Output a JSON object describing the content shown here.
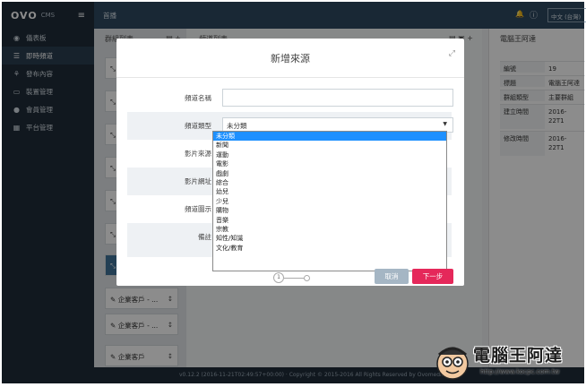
{
  "brand": {
    "logo": "OVO",
    "cms": "CMS",
    "menu_icon": "hamburger-icon"
  },
  "sidebar": {
    "items": [
      {
        "label": "儀表板",
        "icon": "dashboard-icon",
        "active": false
      },
      {
        "label": "即時頻道",
        "icon": "list-icon",
        "active": true
      },
      {
        "label": "發布內容",
        "icon": "share-icon",
        "active": false
      },
      {
        "label": "裝置管理",
        "icon": "monitor-icon",
        "active": false
      },
      {
        "label": "會員管理",
        "icon": "user-icon",
        "active": false
      },
      {
        "label": "平台管理",
        "icon": "grid-icon",
        "active": false
      }
    ]
  },
  "topbar": {
    "breadcrumb": "首播",
    "language": "中文 (台灣)"
  },
  "left_column": {
    "title": "群組列表",
    "cards": [
      "",
      "",
      "",
      "",
      "",
      "",
      "",
      "",
      "企業客戶 - ...",
      "企業客戶 - ...",
      "企業客戶"
    ]
  },
  "middle_column": {
    "title": "頻道列表"
  },
  "right_column": {
    "title": "電腦王阿達",
    "rows": [
      {
        "k": "編號",
        "v": "19"
      },
      {
        "k": "標題",
        "v": "電腦王阿達"
      },
      {
        "k": "群組類型",
        "v": "主要群組"
      },
      {
        "k": "建立時間",
        "v": "2016-\n22T1"
      },
      {
        "k": "修改時間",
        "v": "2016-\n22T1"
      }
    ]
  },
  "footer": {
    "text": "v0.12.2 (2016-11-21T02:49:57+00:00) · Copyright © 2015-2016 All Rights Reserved by Ovomedia"
  },
  "modal": {
    "title": "新增來源",
    "fields": [
      {
        "label": "頻道名稱"
      },
      {
        "label": "頻道類型",
        "value": "未分類"
      },
      {
        "label": "影片來源"
      },
      {
        "label": "影片網址"
      },
      {
        "label": "頻道圖示"
      },
      {
        "label": "備註"
      }
    ],
    "options": [
      "未分類",
      "新聞",
      "運動",
      "電影",
      "戲劇",
      "綜合",
      "幼兒",
      "少兒",
      "購物",
      "音樂",
      "宗教",
      "知性/知識",
      "文化/教育"
    ],
    "step": "1",
    "cancel_label": "取消",
    "next_label": "下一步"
  },
  "watermark": {
    "title": "電腦王阿達",
    "url": "http://www.kocpc.com.tw"
  }
}
